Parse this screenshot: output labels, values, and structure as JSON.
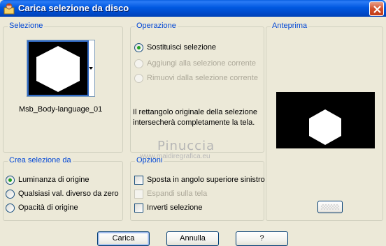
{
  "window": {
    "title": "Carica selezione da disco",
    "close_icon": "close-icon"
  },
  "selezione": {
    "title": "Selezione",
    "selected_name": "Msb_Body-language_01"
  },
  "operazione": {
    "title": "Operazione",
    "options": [
      {
        "label": "Sostituisci selezione",
        "checked": true,
        "enabled": true
      },
      {
        "label": "Aggiungi alla selezione corrente",
        "checked": false,
        "enabled": false
      },
      {
        "label": "Rimuovi dalla selezione corrente",
        "checked": false,
        "enabled": false
      }
    ],
    "info": "Il rettangolo originale della selezione intersecherà completamente la tela."
  },
  "anteprima": {
    "title": "Anteprima"
  },
  "crea_selezione": {
    "title": "Crea selezione da",
    "options": [
      {
        "label": "Luminanza di origine",
        "checked": true
      },
      {
        "label": "Qualsiasi val. diverso da zero",
        "checked": false
      },
      {
        "label": "Opacità di origine",
        "checked": false
      }
    ]
  },
  "opzioni": {
    "title": "Opzioni",
    "options": [
      {
        "label": "Sposta in angolo superiore sinistro",
        "checked": false,
        "enabled": true
      },
      {
        "label": "Espandi sulla tela",
        "checked": false,
        "enabled": false
      },
      {
        "label": "Inverti selezione",
        "checked": false,
        "enabled": true
      }
    ]
  },
  "watermark": {
    "name": "Pinuccia",
    "url": "www.maidiregrafica.eu"
  },
  "buttons": {
    "carica": "Carica",
    "annulla": "Annulla",
    "help": "?"
  },
  "colors": {
    "title_bar": "#0058e0",
    "group_title": "#0046d5",
    "dialog_bg": "#ece9d8"
  }
}
